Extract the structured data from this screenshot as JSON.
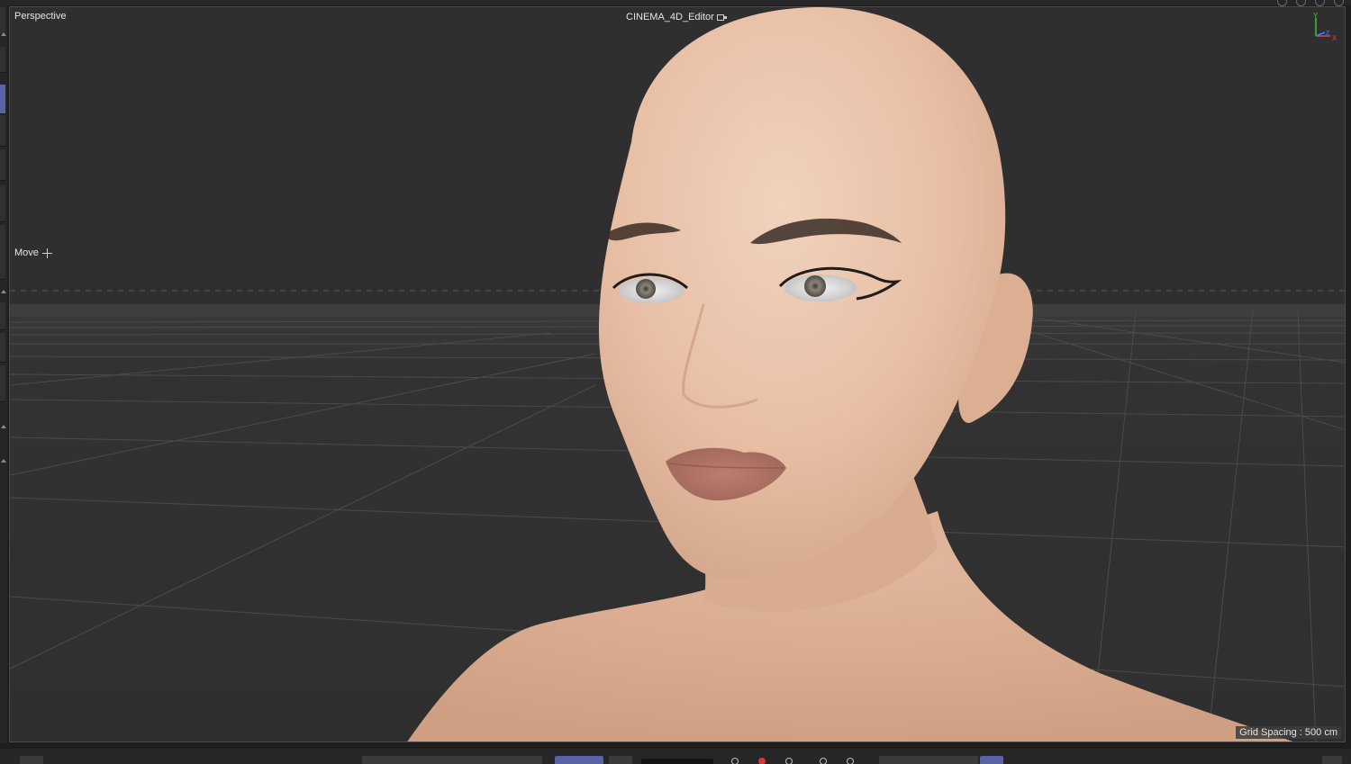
{
  "viewport": {
    "view_name": "Perspective",
    "camera_name": "CINEMA_4D_Editor",
    "tool_label": "Move",
    "grid_spacing": "Grid Spacing : 500 cm"
  },
  "axis": {
    "y": "Y",
    "z": "Z",
    "x": "X"
  },
  "colors": {
    "viewport_bg": "#2f2f2f",
    "accent": "#5b63a8",
    "axis_x": "#e04040",
    "axis_y": "#40c040",
    "axis_z": "#4080ff",
    "record": "#d23a3a"
  },
  "icons": {
    "camera": "camera-icon",
    "move": "move-icon",
    "record": "record-icon"
  }
}
